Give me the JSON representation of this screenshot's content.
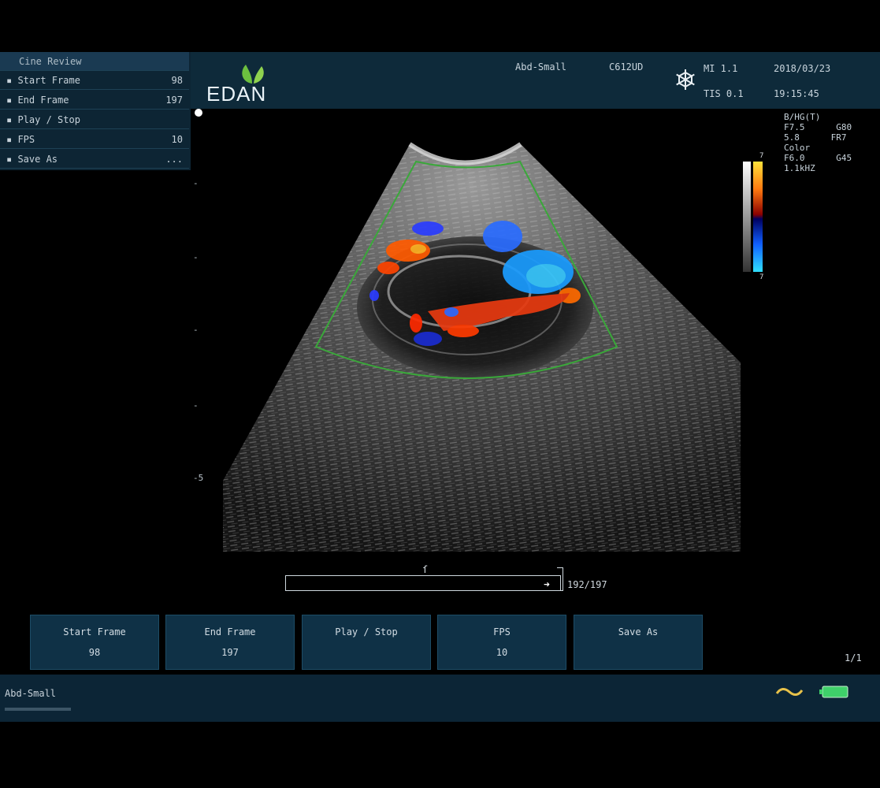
{
  "header": {
    "brand": "EDAN",
    "preset": "Abd-Small",
    "probe": "C612UD",
    "mi": "MI  1.1",
    "tis": "TIS 0.1",
    "date": "2018/03/23",
    "time": "19:15:45",
    "freeze_icon": "snowflake-icon"
  },
  "side_menu": {
    "title": "Cine Review",
    "items": [
      {
        "label": "Start Frame",
        "value": "98"
      },
      {
        "label": "End Frame",
        "value": "197"
      },
      {
        "label": "Play / Stop",
        "value": ""
      },
      {
        "label": "FPS",
        "value": "10"
      },
      {
        "label": "Save As",
        "value": "..."
      }
    ]
  },
  "image_params": {
    "lines": [
      "B/HG(T)",
      "F7.5",
      "5.8",
      "Color",
      "F6.0",
      "1.1kHZ"
    ],
    "right_col": [
      "G80",
      "FR7",
      "G45"
    ]
  },
  "depth_labels": [
    "-5"
  ],
  "color_scale": {
    "top": "7",
    "bottom": "7"
  },
  "cine": {
    "counter": "192/197",
    "current": 192,
    "total": 197
  },
  "soft_buttons": [
    {
      "line1": "Start Frame",
      "line2": "98"
    },
    {
      "line1": "End Frame",
      "line2": "197"
    },
    {
      "line1": "Play / Stop",
      "line2": ""
    },
    {
      "line1": "FPS",
      "line2": "10"
    },
    {
      "line1": "Save As",
      "line2": ""
    }
  ],
  "page_indicator": "1/1",
  "status": {
    "preset": "Abd-Small",
    "wave_icon": "wave-icon",
    "battery_icon": "battery-icon"
  },
  "colors": {
    "panel": "#0e2a3a",
    "button": "#0f3146",
    "logo_leaf": "#6cbf3f",
    "battery": "#3fd06a",
    "wave": "#e8c24a"
  }
}
